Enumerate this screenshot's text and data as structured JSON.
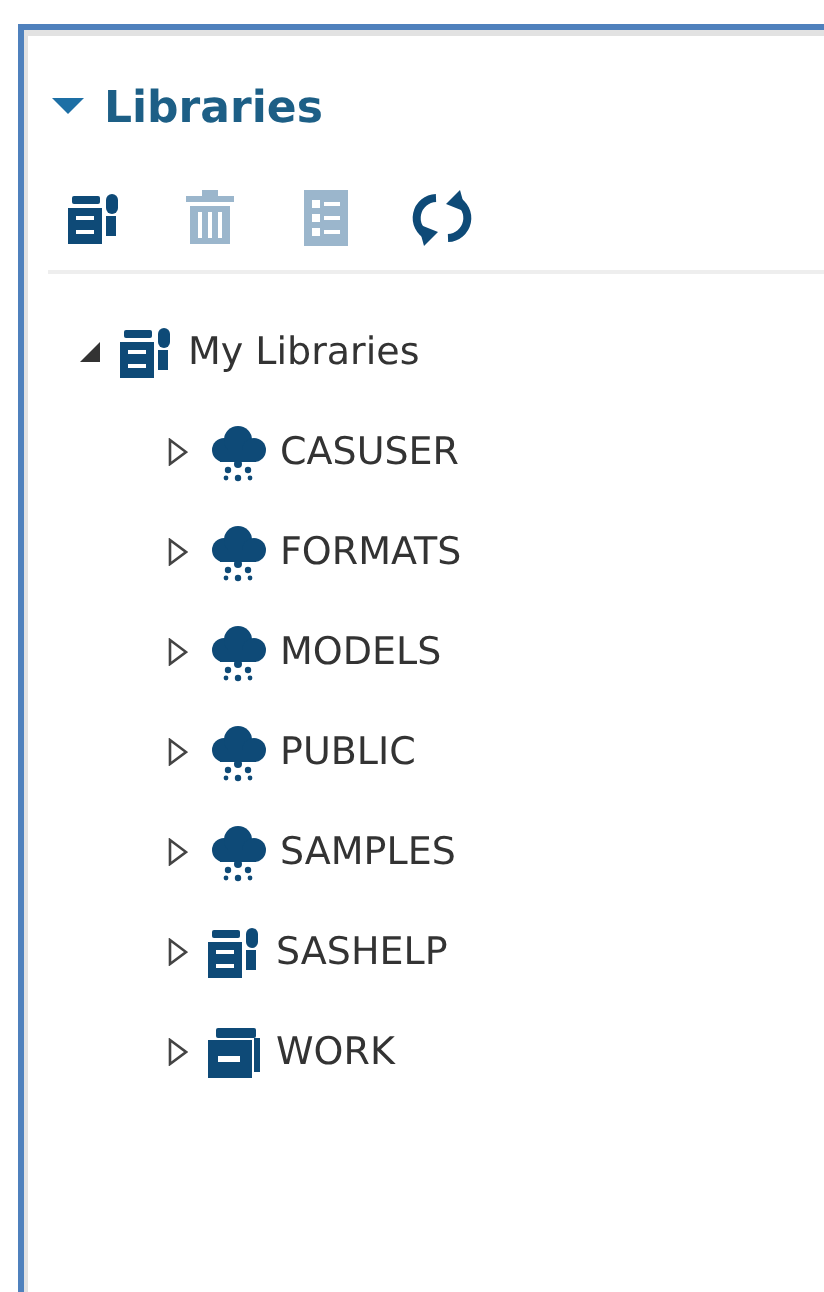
{
  "panel": {
    "title": "Libraries",
    "expanded": true
  },
  "toolbar": [
    {
      "kind": "library",
      "disabled": false
    },
    {
      "kind": "trash",
      "disabled": true
    },
    {
      "kind": "list",
      "disabled": true
    },
    {
      "kind": "refresh",
      "disabled": false
    }
  ],
  "tree": [
    {
      "label": "My Libraries",
      "kind": "library",
      "expanded": true,
      "children": [
        {
          "label": "CASUSER",
          "kind": "cloud",
          "expanded": false
        },
        {
          "label": "FORMATS",
          "kind": "cloud",
          "expanded": false
        },
        {
          "label": "MODELS",
          "kind": "cloud",
          "expanded": false
        },
        {
          "label": "PUBLIC",
          "kind": "cloud",
          "expanded": false
        },
        {
          "label": "SAMPLES",
          "kind": "cloud",
          "expanded": false
        },
        {
          "label": "SASHELP",
          "kind": "library",
          "expanded": false
        },
        {
          "label": "WORK",
          "kind": "drawer",
          "expanded": false
        }
      ]
    }
  ]
}
